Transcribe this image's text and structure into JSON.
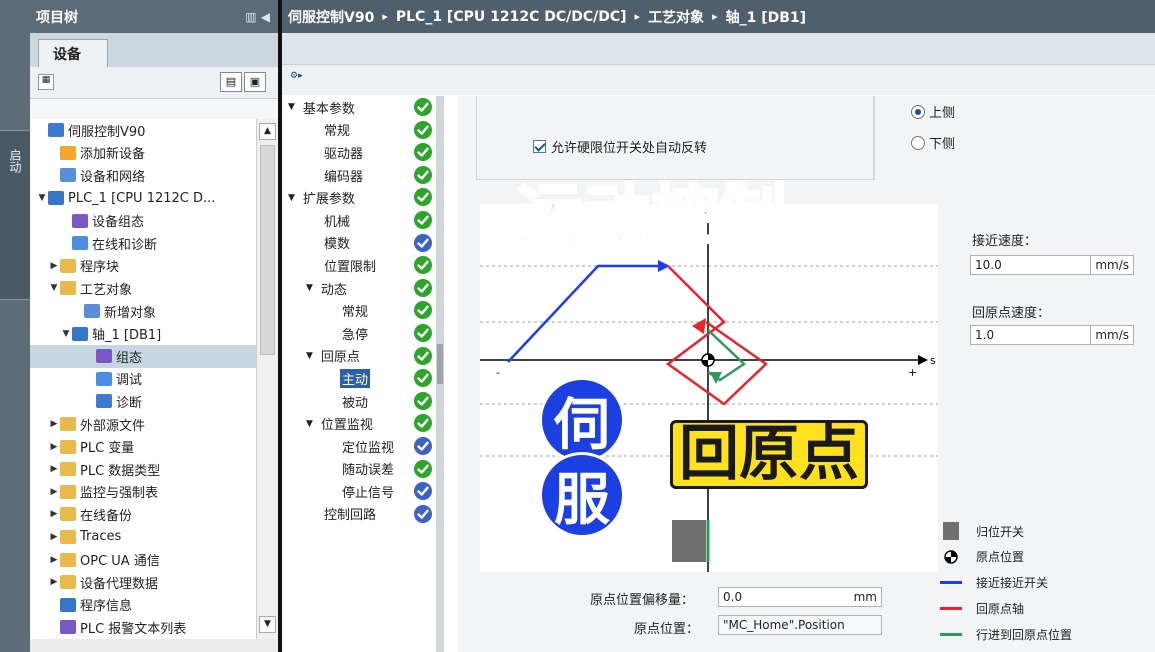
{
  "left_strip": {
    "label": "启动"
  },
  "tree": {
    "title": "项目树",
    "tab": "设备",
    "items": [
      {
        "label": "伺服控制V90",
        "indent": 0,
        "arrow": "",
        "icon": "project-icon"
      },
      {
        "label": "添加新设备",
        "indent": 1,
        "arrow": "",
        "icon": "add-device-icon"
      },
      {
        "label": "设备和网络",
        "indent": 1,
        "arrow": "",
        "icon": "network-icon"
      },
      {
        "label": "PLC_1 [CPU 1212C D...",
        "indent": 0,
        "arrow": "▼",
        "icon": "plc-icon"
      },
      {
        "label": "设备组态",
        "indent": 2,
        "arrow": "",
        "icon": "device-config-icon"
      },
      {
        "label": "在线和诊断",
        "indent": 2,
        "arrow": "",
        "icon": "diagnostics-icon"
      },
      {
        "label": "程序块",
        "indent": 1,
        "arrow": "▶",
        "icon": "folder-icon"
      },
      {
        "label": "工艺对象",
        "indent": 1,
        "arrow": "▼",
        "icon": "folder-icon"
      },
      {
        "label": "新增对象",
        "indent": 3,
        "arrow": "",
        "icon": "add-object-icon"
      },
      {
        "label": "轴_1 [DB1]",
        "indent": 2,
        "arrow": "▼",
        "icon": "axis-icon"
      },
      {
        "label": "组态",
        "indent": 4,
        "arrow": "",
        "icon": "config-icon",
        "selected": true
      },
      {
        "label": "调试",
        "indent": 4,
        "arrow": "",
        "icon": "commissioning-icon"
      },
      {
        "label": "诊断",
        "indent": 4,
        "arrow": "",
        "icon": "diagnose-icon"
      },
      {
        "label": "外部源文件",
        "indent": 1,
        "arrow": "▶",
        "icon": "folder-icon"
      },
      {
        "label": "PLC 变量",
        "indent": 1,
        "arrow": "▶",
        "icon": "folder-icon"
      },
      {
        "label": "PLC 数据类型",
        "indent": 1,
        "arrow": "▶",
        "icon": "folder-icon"
      },
      {
        "label": "监控与强制表",
        "indent": 1,
        "arrow": "▶",
        "icon": "folder-icon"
      },
      {
        "label": "在线备份",
        "indent": 1,
        "arrow": "▶",
        "icon": "folder-icon"
      },
      {
        "label": "Traces",
        "indent": 1,
        "arrow": "▶",
        "icon": "folder-icon"
      },
      {
        "label": "OPC UA 通信",
        "indent": 1,
        "arrow": "▶",
        "icon": "folder-icon"
      },
      {
        "label": "设备代理数据",
        "indent": 1,
        "arrow": "▶",
        "icon": "folder-icon"
      },
      {
        "label": "程序信息",
        "indent": 1,
        "arrow": "",
        "icon": "program-info-icon"
      },
      {
        "label": "PLC 报警文本列表",
        "indent": 1,
        "arrow": "",
        "icon": "alarm-text-icon"
      }
    ]
  },
  "breadcrumb": {
    "items": [
      "伺服控制V90",
      "PLC_1 [CPU 1212C DC/DC/DC]",
      "工艺对象",
      "轴_1 [DB1]"
    ],
    "separator": "▸"
  },
  "nav": {
    "items": [
      {
        "label": "基本参数",
        "level": 0,
        "arrow": "▼",
        "status": "ok"
      },
      {
        "label": "常规",
        "level": 1,
        "arrow": "",
        "status": "ok"
      },
      {
        "label": "驱动器",
        "level": 1,
        "arrow": "",
        "status": "ok"
      },
      {
        "label": "编码器",
        "level": 1,
        "arrow": "",
        "status": "ok"
      },
      {
        "label": "扩展参数",
        "level": 0,
        "arrow": "▼",
        "status": "ok"
      },
      {
        "label": "机械",
        "level": 1,
        "arrow": "",
        "status": "ok"
      },
      {
        "label": "模数",
        "level": 1,
        "arrow": "",
        "status": "info"
      },
      {
        "label": "位置限制",
        "level": 1,
        "arrow": "",
        "status": "ok"
      },
      {
        "label": "动态",
        "level": 1,
        "arrow": "▼",
        "status": "ok"
      },
      {
        "label": "常规",
        "level": 2,
        "arrow": "",
        "status": "ok"
      },
      {
        "label": "急停",
        "level": 2,
        "arrow": "",
        "status": "ok"
      },
      {
        "label": "回原点",
        "level": 1,
        "arrow": "▼",
        "status": "ok"
      },
      {
        "label": "主动",
        "level": 2,
        "arrow": "",
        "status": "ok",
        "selected": true
      },
      {
        "label": "被动",
        "level": 2,
        "arrow": "",
        "status": "ok"
      },
      {
        "label": "位置监视",
        "level": 1,
        "arrow": "▼",
        "status": "ok"
      },
      {
        "label": "定位监视",
        "level": 2,
        "arrow": "",
        "status": "info"
      },
      {
        "label": "随动误差",
        "level": 2,
        "arrow": "",
        "status": "ok"
      },
      {
        "label": "停止信号",
        "level": 2,
        "arrow": "",
        "status": "info"
      },
      {
        "label": "控制回路",
        "level": 1,
        "arrow": "",
        "status": "info"
      }
    ],
    "status_colors": {
      "ok": "#2da52d",
      "info": "#3b63c4"
    }
  },
  "settings": {
    "auto_reverse_label": "允许硬限位开关处自动反转",
    "radio_upper": "上侧",
    "radio_lower": "下侧",
    "approach_speed_label": "接近速度：",
    "approach_speed_value": "10.0",
    "homing_speed_label": "回原点速度：",
    "homing_speed_value": "1.0",
    "speed_unit": "mm/s",
    "home_offset_label": "原点位置偏移量：",
    "home_offset_value": "0.0",
    "home_offset_unit": "mm",
    "home_position_label": "原点位置：",
    "home_position_value": "\"MC_Home\".Position"
  },
  "diagram": {
    "axis_label": "s",
    "minus": "-",
    "plus": "+",
    "colors": {
      "approach": "#1e3cf0",
      "homing": "#e8232c",
      "travel": "#2e9a5a",
      "switch": "#707070"
    }
  },
  "legend": [
    {
      "label": "归位开关",
      "mark": "switch"
    },
    {
      "label": "原点位置",
      "mark": "origin"
    },
    {
      "label": "接近接近开关",
      "mark": "approach"
    },
    {
      "label": "回原点轴",
      "mark": "homing"
    },
    {
      "label": "行进到回原点位置",
      "mark": "travel"
    }
  ],
  "overlay": {
    "title": "运动控制",
    "servo_char_1": "伺",
    "servo_char_2": "服",
    "homing_title": "回原点"
  }
}
